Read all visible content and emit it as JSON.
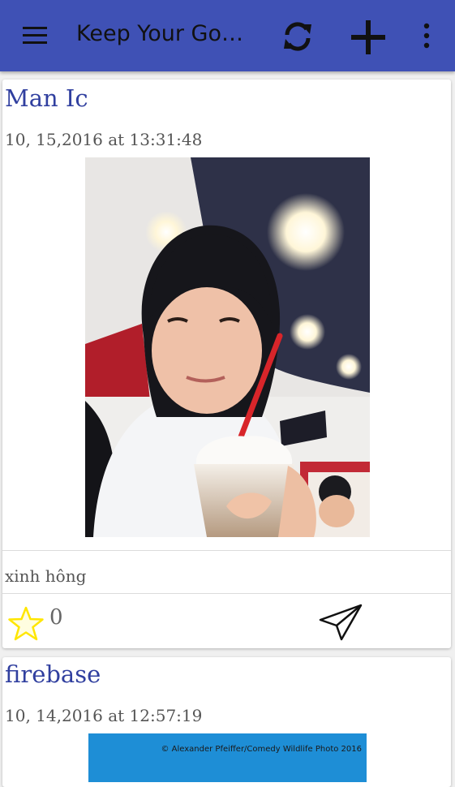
{
  "app_bar": {
    "title": "Keep Your Go…",
    "icons": {
      "menu": "menu-icon",
      "refresh": "refresh-icon",
      "add": "add-icon",
      "more": "more-vert-icon"
    },
    "colors": {
      "background": "#3f51b5",
      "icon": "#111111"
    }
  },
  "posts": [
    {
      "title": "Man Ic",
      "date": "10, 15,2016 at 13:31:48",
      "caption": "xinh hông",
      "likes": "0",
      "star_icon": "star-outline-icon",
      "share_icon": "send-icon"
    },
    {
      "title": "firebase",
      "date": "10, 14,2016 at 12:57:19",
      "image_credit": "© Alexander Pfeiffer/Comedy Wildlife Photo 2016"
    }
  ],
  "colors": {
    "title": "#303f9f",
    "star": "#ffeb3b",
    "second_image": "#1e8ed6"
  }
}
